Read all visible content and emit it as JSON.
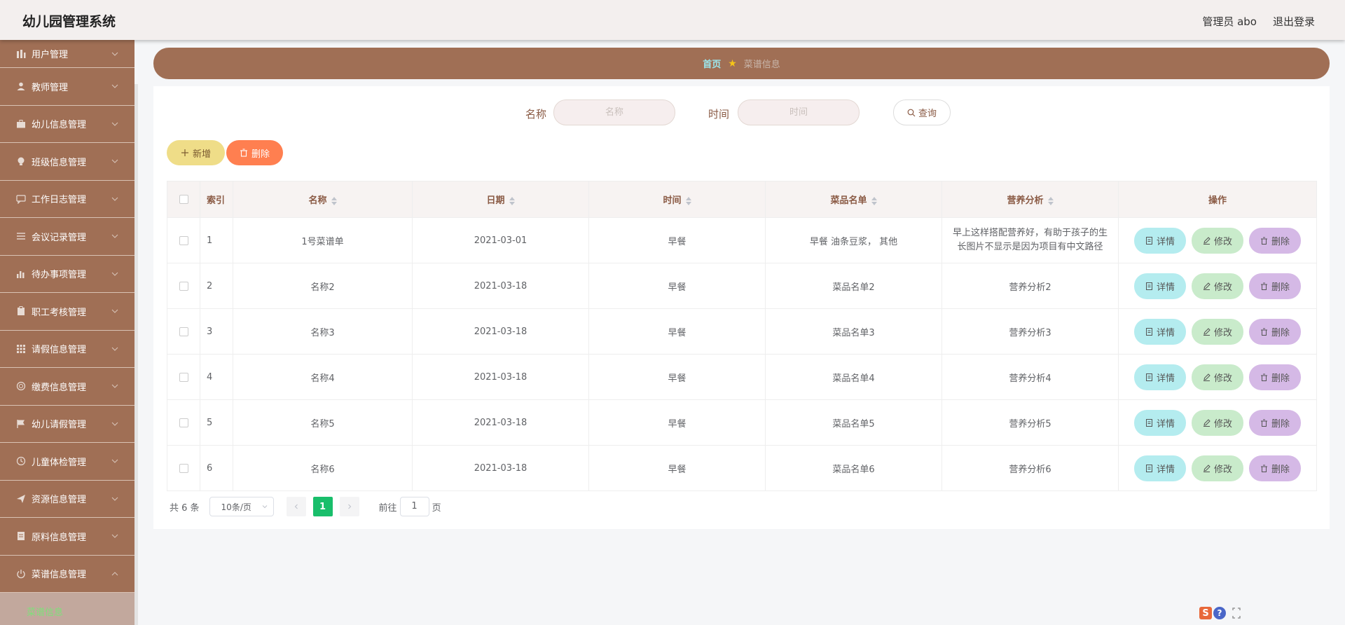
{
  "header": {
    "brand": "幼儿园管理系统",
    "user": "管理员 abo",
    "logout": "退出登录"
  },
  "sidebar": {
    "items": [
      {
        "label": "用户管理",
        "icon": "bars-icon"
      },
      {
        "label": "教师管理",
        "icon": "user-icon"
      },
      {
        "label": "幼儿信息管理",
        "icon": "briefcase-icon"
      },
      {
        "label": "班级信息管理",
        "icon": "bulb-icon"
      },
      {
        "label": "工作日志管理",
        "icon": "chat-icon"
      },
      {
        "label": "会议记录管理",
        "icon": "list-icon"
      },
      {
        "label": "待办事项管理",
        "icon": "chart-icon"
      },
      {
        "label": "职工考核管理",
        "icon": "clipboard-icon"
      },
      {
        "label": "请假信息管理",
        "icon": "grid-icon"
      },
      {
        "label": "缴费信息管理",
        "icon": "coin-icon"
      },
      {
        "label": "幼儿请假管理",
        "icon": "flag-icon"
      },
      {
        "label": "儿童体检管理",
        "icon": "clock-icon"
      },
      {
        "label": "资源信息管理",
        "icon": "send-icon"
      },
      {
        "label": "原料信息管理",
        "icon": "doc-icon"
      },
      {
        "label": "菜谱信息管理",
        "icon": "power-icon"
      }
    ],
    "sub_item": "菜谱信息"
  },
  "breadcrumb": {
    "home": "首页",
    "current": "菜谱信息"
  },
  "search": {
    "name_label": "名称",
    "name_placeholder": "名称",
    "time_label": "时间",
    "time_placeholder": "时间",
    "query_button": "查询"
  },
  "actions": {
    "add": "新增",
    "delete": "删除"
  },
  "table": {
    "headers": [
      "索引",
      "名称",
      "日期",
      "时间",
      "菜品名单",
      "营养分析",
      "操作"
    ],
    "rows": [
      {
        "index": "1",
        "name": "1号菜谱单",
        "date": "2021-03-01",
        "time": "早餐",
        "dishes": "早餐 油条豆浆， 其他",
        "nutrition": "早上这样搭配营养好，有助于孩子的生长图片不显示是因为项目有中文路径"
      },
      {
        "index": "2",
        "name": "名称2",
        "date": "2021-03-18",
        "time": "早餐",
        "dishes": "菜品名单2",
        "nutrition": "营养分析2"
      },
      {
        "index": "3",
        "name": "名称3",
        "date": "2021-03-18",
        "time": "早餐",
        "dishes": "菜品名单3",
        "nutrition": "营养分析3"
      },
      {
        "index": "4",
        "name": "名称4",
        "date": "2021-03-18",
        "time": "早餐",
        "dishes": "菜品名单4",
        "nutrition": "营养分析4"
      },
      {
        "index": "5",
        "name": "名称5",
        "date": "2021-03-18",
        "time": "早餐",
        "dishes": "菜品名单5",
        "nutrition": "营养分析5"
      },
      {
        "index": "6",
        "name": "名称6",
        "date": "2021-03-18",
        "time": "早餐",
        "dishes": "菜品名单6",
        "nutrition": "营养分析6"
      }
    ],
    "op_detail": "详情",
    "op_edit": "修改",
    "op_delete": "删除"
  },
  "pagination": {
    "total": "共 6 条",
    "page_size": "10条/页",
    "current_page": "1",
    "goto_prefix": "前往",
    "goto_value": "1",
    "goto_suffix": "页"
  },
  "colors": {
    "sidebar": "#a06f55",
    "accent_green": "#19be6b",
    "delete": "#ff7f50",
    "add": "#efdd88"
  }
}
